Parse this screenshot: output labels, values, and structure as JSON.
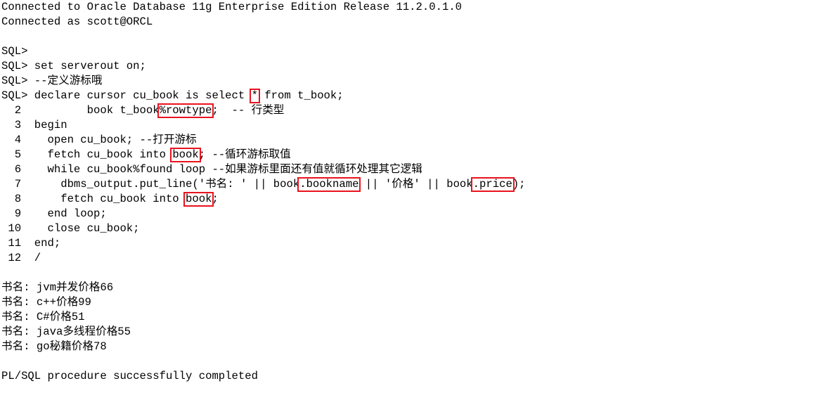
{
  "terminal": {
    "lines": [
      {
        "text": "Connected to Oracle Database 11g Enterprise Edition Release 11.2.0.1.0"
      },
      {
        "text": "Connected as scott@ORCL"
      },
      {
        "text": ""
      },
      {
        "text": "SQL>"
      },
      {
        "text": "SQL> set serverout on;"
      },
      {
        "text": "SQL> --定义游标哦"
      },
      {
        "pre": "SQL> declare cursor cu_book is select ",
        "hl": "*",
        "post": " from t_book;"
      },
      {
        "pre": "  2          book t_book",
        "hl": "%rowtype",
        "post": ";  -- 行类型"
      },
      {
        "text": "  3  begin"
      },
      {
        "text": "  4    open cu_book; --打开游标"
      },
      {
        "pre": "  5    fetch cu_book into ",
        "hl": "book",
        "post": "; --循环游标取值"
      },
      {
        "text": "  6    while cu_book%found loop --如果游标里面还有值就循环处理其它逻辑"
      },
      {
        "pre": "  7      dbms_output.put_line('书名: ' || book",
        "hl": ".bookname",
        "mid": " || '价格' || book",
        "hl2": ".price",
        "post": ");"
      },
      {
        "pre": "  8      fetch cu_book into ",
        "hl": "book",
        "post": ";"
      },
      {
        "text": "  9    end loop;"
      },
      {
        "text": " 10    close cu_book;"
      },
      {
        "text": " 11  end;"
      },
      {
        "text": " 12  /"
      },
      {
        "text": ""
      },
      {
        "text": "书名: jvm并发价格66"
      },
      {
        "text": "书名: c++价格99"
      },
      {
        "text": "书名: C#价格51"
      },
      {
        "text": "书名: java多线程价格55"
      },
      {
        "text": "书名: go秘籍价格78"
      },
      {
        "text": ""
      },
      {
        "text": "PL/SQL procedure successfully completed"
      }
    ]
  },
  "colors": {
    "background": "#ffffff",
    "text": "#000000",
    "highlight_border": "#e8131f"
  }
}
